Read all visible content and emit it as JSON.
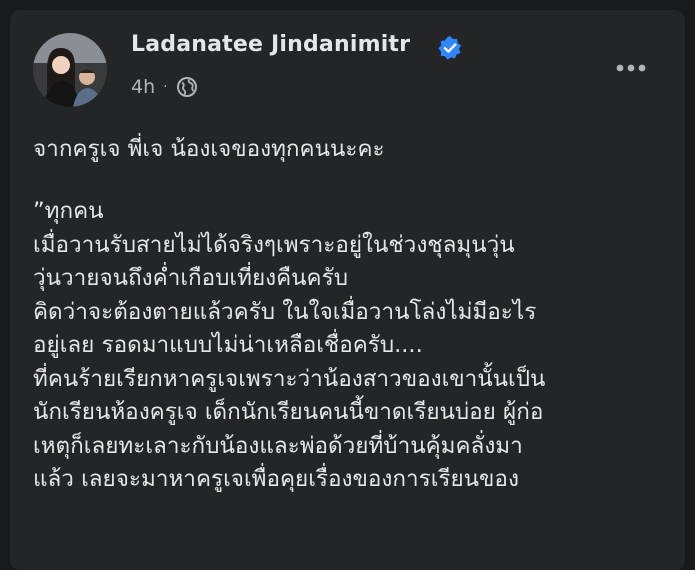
{
  "post": {
    "author": "Ladanatee Jindanimitr",
    "verified": true,
    "time": "4h",
    "separator": "·",
    "privacy_icon": "globe-icon",
    "more_icon": "more-options-icon",
    "headline": "จากครูเจ พี่เจ น้องเจของทุกคนนะคะ",
    "body_lines": [
      "”ทุกคน",
      "เมื่อวานรับสายไม่ได้จริงๆเพราะอยู่ในช่วงชุลมุนวุ่น",
      "วุ่นวายจนถึงค่ำเกือบเที่ยงคืนครับ",
      "คิดว่าจะต้องตายแล้วครับ ในใจเมื่อวานโล่งไม่มีอะไร",
      "อยู่เลย รอดมาแบบไม่น่าเหลือเชื่อครับ....",
      "ที่คนร้ายเรียกหาครูเจเพราะว่าน้องสาวของเขานั้นเป็น",
      "นักเรียนห้องครูเจ เด็กนักเรียนคนนี้ขาดเรียนบ่อย ผู้ก่อ",
      "เหตุก็เลยทะเลาะกับน้องและพ่อด้วยที่บ้านคุ้มคลั่งมา",
      "แล้ว เลยจะมาหาครูเจเพื่อคุยเรื่องของการเรียนของ"
    ]
  },
  "colors": {
    "page_bg": "#18191a",
    "card_bg": "#242526",
    "primary_text": "#e4e6eb",
    "secondary_text": "#b0b3b8",
    "verified_blue": "#2d88ff"
  }
}
